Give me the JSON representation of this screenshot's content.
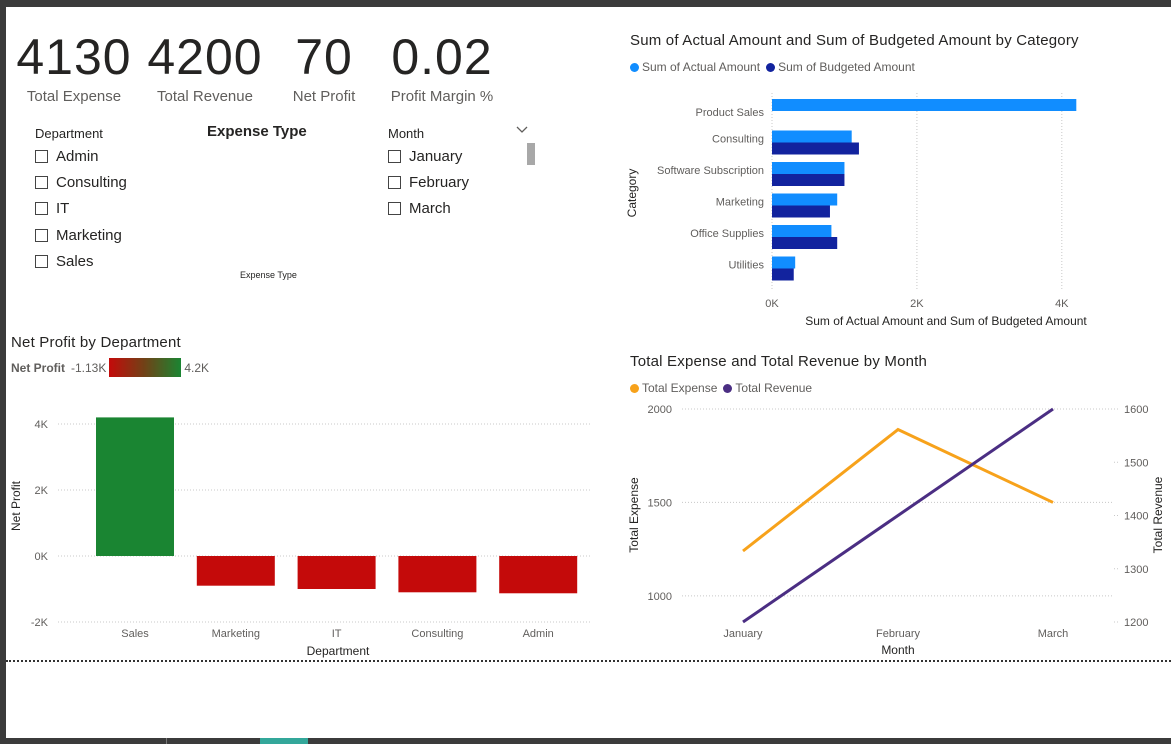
{
  "kpis": [
    {
      "value": "4130",
      "label": "Total Expense"
    },
    {
      "value": "4200",
      "label": "Total Revenue"
    },
    {
      "value": "70",
      "label": "Net Profit"
    },
    {
      "value": "0.02",
      "label": "Profit Margin %"
    }
  ],
  "department_slicer": {
    "title": "Department",
    "items": [
      "Admin",
      "Consulting",
      "IT",
      "Marketing",
      "Sales"
    ]
  },
  "expense_type_slicer": {
    "title": "Expense Type",
    "caption": "Expense Type"
  },
  "month_slicer": {
    "title": "Month",
    "items": [
      "January",
      "February",
      "March"
    ]
  },
  "colors": {
    "actual": "#118dff",
    "budgeted": "#12239e",
    "expense": "#f7a21b",
    "revenue": "#4b2e83",
    "profit_pos": "#1a8532",
    "profit_neg": "#c40a0a"
  },
  "category_chart": {
    "title": "Sum of Actual Amount and Sum of Budgeted Amount by Category",
    "legend": [
      "Sum of Actual Amount",
      "Sum of Budgeted Amount"
    ],
    "xlabel": "Sum of Actual Amount and Sum of Budgeted Amount",
    "ylabel": "Category",
    "ticks": [
      "0K",
      "2K",
      "4K"
    ]
  },
  "profit_chart": {
    "title": "Net Profit by Department",
    "legend_label": "Net Profit",
    "legend_min": "-1.13K",
    "legend_max": "4.2K",
    "xlabel": "Department",
    "ylabel": "Net Profit",
    "ticks": [
      "4K",
      "2K",
      "0K",
      "-2K"
    ]
  },
  "month_chart": {
    "title": "Total Expense and Total Revenue by Month",
    "legend": [
      "Total Expense",
      "Total Revenue"
    ],
    "xlabel": "Month",
    "ylabel_left": "Total Expense",
    "ylabel_right": "Total Revenue",
    "left_ticks": [
      "2000",
      "1500",
      "1000"
    ],
    "right_ticks": [
      "1600",
      "1500",
      "1400",
      "1300",
      "1200"
    ]
  },
  "chart_data": [
    {
      "type": "bar",
      "orientation": "horizontal",
      "title": "Sum of Actual Amount and Sum of Budgeted Amount by Category",
      "xlabel": "Sum of Actual Amount and Sum of Budgeted Amount",
      "ylabel": "Category",
      "categories": [
        "Product Sales",
        "Consulting",
        "Software Subscription",
        "Marketing",
        "Office Supplies",
        "Utilities"
      ],
      "series": [
        {
          "name": "Sum of Actual Amount",
          "values": [
            4200,
            1100,
            1000,
            900,
            820,
            320
          ]
        },
        {
          "name": "Sum of Budgeted Amount",
          "values": [
            0,
            1200,
            1000,
            800,
            900,
            300
          ]
        }
      ],
      "xlim": [
        0,
        5300
      ],
      "grid": true,
      "legend_position": "top-left"
    },
    {
      "type": "bar",
      "title": "Net Profit by Department",
      "xlabel": "Department",
      "ylabel": "Net Profit",
      "categories": [
        "Sales",
        "Marketing",
        "IT",
        "Consulting",
        "Admin"
      ],
      "values": [
        4200,
        -900,
        -1000,
        -1100,
        -1130
      ],
      "ylim": [
        -2000,
        4000
      ],
      "grid": true
    },
    {
      "type": "line",
      "title": "Total Expense and Total Revenue by Month",
      "xlabel": "Month",
      "categories": [
        "January",
        "February",
        "March"
      ],
      "series": [
        {
          "name": "Total Expense",
          "axis": "left",
          "values": [
            1240,
            1890,
            1500
          ]
        },
        {
          "name": "Total Revenue",
          "axis": "right",
          "values": [
            1200,
            1400,
            1600
          ]
        }
      ],
      "ylim_left": [
        1000,
        2000
      ],
      "ylim_right": [
        1200,
        1600
      ],
      "legend_position": "top-left"
    }
  ]
}
